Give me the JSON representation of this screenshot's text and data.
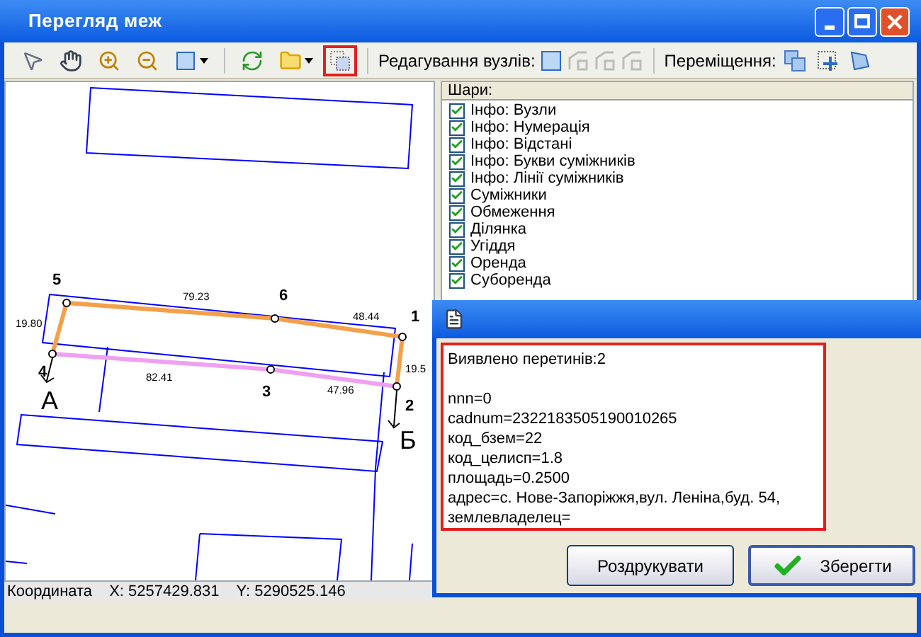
{
  "window": {
    "title": "Перегляд меж"
  },
  "toolbar": {
    "buttons": [
      {
        "kind": "pointer",
        "highlighted": false
      },
      {
        "kind": "hand",
        "highlighted": false
      },
      {
        "kind": "zoom-in",
        "highlighted": false
      },
      {
        "kind": "zoom-out",
        "highlighted": false
      },
      {
        "kind": "extent",
        "highlighted": false
      },
      {
        "kind": "refresh",
        "highlighted": false
      },
      {
        "kind": "folder",
        "highlighted": false
      },
      {
        "kind": "overlap",
        "highlighted": true
      }
    ],
    "node_edit_label": "Редагування вузлів:",
    "node_edit_buttons": [
      {
        "kind": "square",
        "disabled": false
      },
      {
        "kind": "node",
        "disabled": true
      },
      {
        "kind": "node",
        "disabled": true
      },
      {
        "kind": "node",
        "disabled": true
      }
    ],
    "move_label": "Переміщення:",
    "move_buttons": [
      {
        "kind": "move"
      },
      {
        "kind": "move-node"
      },
      {
        "kind": "move-shape"
      }
    ]
  },
  "map": {
    "labels": [
      {
        "text": "5",
        "kind": "node"
      },
      {
        "text": "6",
        "kind": "node"
      },
      {
        "text": "1",
        "kind": "node"
      },
      {
        "text": "4",
        "kind": "node"
      },
      {
        "text": "3",
        "kind": "node"
      },
      {
        "text": "2",
        "kind": "node"
      },
      {
        "text": "А",
        "kind": "letter"
      },
      {
        "text": "Б",
        "kind": "letter"
      },
      {
        "text": "79.23",
        "kind": "distance"
      },
      {
        "text": "48.44",
        "kind": "distance"
      },
      {
        "text": "19.80",
        "kind": "distance"
      },
      {
        "text": "19.5",
        "kind": "distance"
      },
      {
        "text": "82.41",
        "kind": "distance"
      },
      {
        "text": "47.96",
        "kind": "distance"
      }
    ]
  },
  "layers": {
    "title": "Шари:",
    "items": [
      {
        "label": "Інфо: Вузли",
        "checked": true
      },
      {
        "label": "Інфо: Нумерація",
        "checked": true
      },
      {
        "label": "Інфо: Відстані",
        "checked": true
      },
      {
        "label": "Інфо: Букви суміжників",
        "checked": true
      },
      {
        "label": "Інфо: Лінії суміжників",
        "checked": true
      },
      {
        "label": "Суміжники",
        "checked": true
      },
      {
        "label": "Обмеження",
        "checked": true
      },
      {
        "label": "Ділянка",
        "checked": true
      },
      {
        "label": "Угіддя",
        "checked": true
      },
      {
        "label": "Оренда",
        "checked": true
      },
      {
        "label": "Суборенда",
        "checked": true
      }
    ]
  },
  "status_bar": {
    "label": "Координата",
    "x": "X: 5257429.831",
    "y": "Y: 5290525.146"
  },
  "dialog": {
    "highlighted": true,
    "paragraphs": [
      [
        "Виявлено перетинів:2"
      ],
      [
        "nnn=0",
        "cadnum=2322183505190010265",
        "код_бзем=22",
        "код_целисп=1.8",
        "площадь=0.2500",
        "адрес=с. Нове-Запоріжжя,вул. Леніна,буд. 54,",
        "землевладелец="
      ]
    ],
    "buttons": [
      {
        "label": "Роздрукувати",
        "default": false
      },
      {
        "label": "Зберегти",
        "default": true
      }
    ]
  }
}
